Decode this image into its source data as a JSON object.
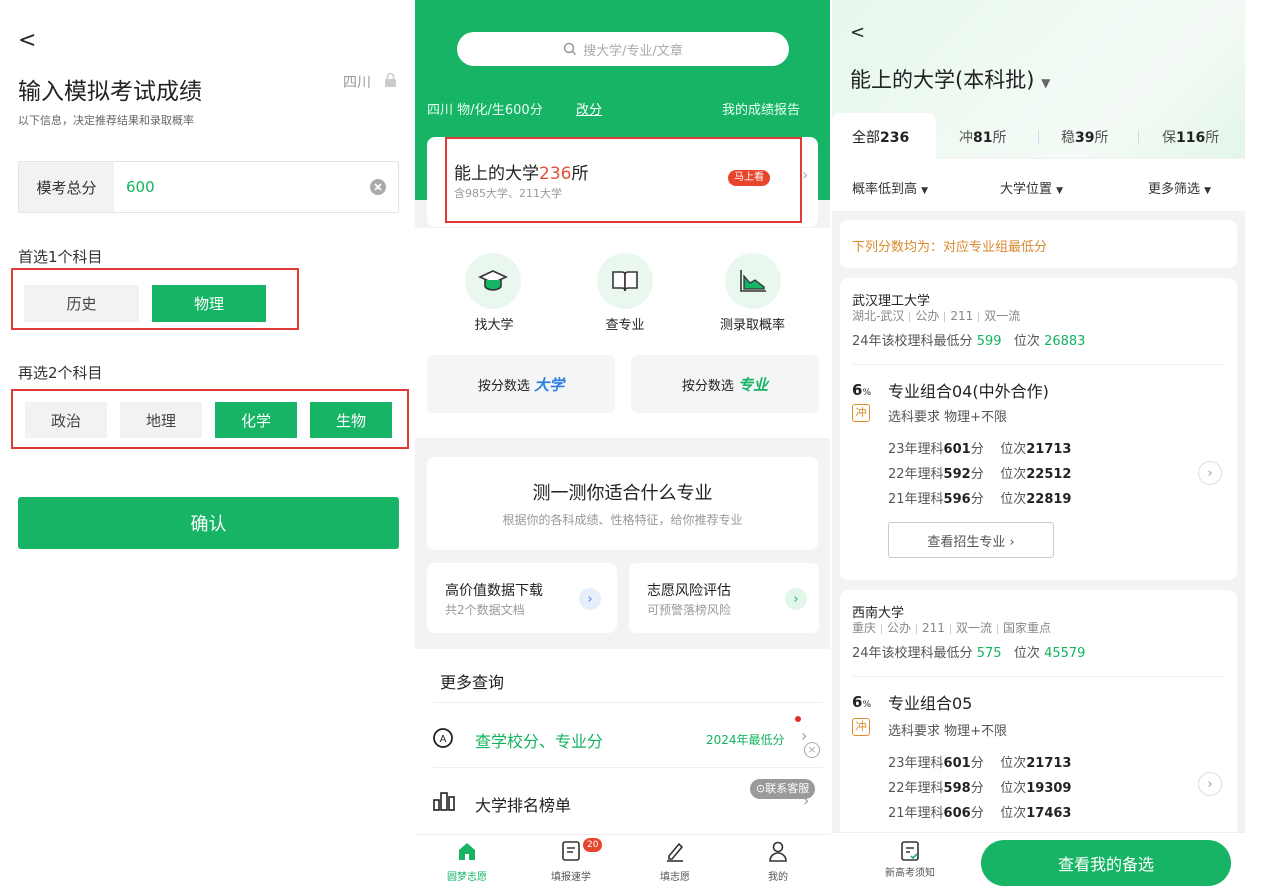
{
  "left": {
    "back": "<",
    "title": "输入模拟考试成绩",
    "province": "四川",
    "subtitle": "以下信息，决定推荐结果和录取概率",
    "score_label": "模考总分",
    "score_value": "600",
    "first_label": "首选1个科目",
    "first_options": [
      "历史",
      "物理"
    ],
    "second_label": "再选2个科目",
    "second_options": [
      "政治",
      "地理",
      "化学",
      "生物"
    ],
    "confirm": "确认"
  },
  "middle": {
    "search_placeholder": "搜大学/专业/文章",
    "info": "四川 物/化/生600分",
    "change": "改分",
    "report": "我的成绩报告",
    "card_title_a": "能上的大学",
    "card_count": "236",
    "card_title_b": "所",
    "card_sub": "含985大学、211大学",
    "badge": "马上看",
    "quick": [
      "找大学",
      "查专业",
      "测录取概率"
    ],
    "score_a_prefix": "按分数选",
    "score_a_suffix": "大学",
    "score_b_prefix": "按分数选",
    "score_b_suffix": "专业",
    "quiz_title": "测一测你适合什么专业",
    "quiz_sub": "根据你的各科成绩、性格特征，给你推荐专业",
    "dl_title": "高价值数据下载",
    "dl_sub": "共2个数据文档",
    "risk_title": "志愿风险评估",
    "risk_sub": "可预警落榜风险",
    "more": "更多查询",
    "query1": "查学校分、专业分",
    "query1_right": "2024年最低分",
    "query2": "大学排名榜单",
    "service": "联系客服",
    "nav": [
      "圆梦志愿",
      "填报速学",
      "填志愿",
      "我的"
    ],
    "nav_badge": "20"
  },
  "right": {
    "back": "<",
    "title": "能上的大学(本科批)",
    "tabs": [
      {
        "a": "全部",
        "b": "236",
        "c": ""
      },
      {
        "a": "冲",
        "b": "81",
        "c": "所"
      },
      {
        "a": "稳",
        "b": "39",
        "c": "所"
      },
      {
        "a": "保",
        "b": "116",
        "c": "所"
      }
    ],
    "filters": [
      "概率低到高",
      "大学位置",
      "更多筛选"
    ],
    "notice": "下列分数均为：对应专业组最低分",
    "schools": [
      {
        "name": "武汉理工大学",
        "tags": [
          "湖北-武汉",
          "公办",
          "211",
          "双一流"
        ],
        "min_prefix": "24年该校理科最低分",
        "min_score": "599",
        "rank_label": "位次",
        "rank": "26883",
        "prob": "6",
        "prob_unit": "%",
        "group": "专业组合04(中外合作)",
        "tag": "冲",
        "req": "选科要求 物理+不限",
        "rows": [
          {
            "y": "23年理科",
            "s": "601",
            "u": "分",
            "rl": "位次",
            "r": "21713"
          },
          {
            "y": "22年理科",
            "s": "592",
            "u": "分",
            "rl": "位次",
            "r": "22512"
          },
          {
            "y": "21年理科",
            "s": "596",
            "u": "分",
            "rl": "位次",
            "r": "22819"
          }
        ],
        "button": "查看招生专业 ›"
      },
      {
        "name": "西南大学",
        "tags": [
          "重庆",
          "公办",
          "211",
          "双一流",
          "国家重点"
        ],
        "min_prefix": "24年该校理科最低分",
        "min_score": "575",
        "rank_label": "位次",
        "rank": "45579",
        "prob": "6",
        "prob_unit": "%",
        "group": "专业组合05",
        "tag": "冲",
        "req": "选科要求 物理+不限",
        "rows": [
          {
            "y": "23年理科",
            "s": "601",
            "u": "分",
            "rl": "位次",
            "r": "21713"
          },
          {
            "y": "22年理科",
            "s": "598",
            "u": "分",
            "rl": "位次",
            "r": "19309"
          },
          {
            "y": "21年理科",
            "s": "606",
            "u": "分",
            "rl": "位次",
            "r": "17463"
          }
        ]
      }
    ],
    "bottom_left": "新高考须知",
    "bottom_btn": "查看我的备选"
  },
  "colors": {
    "green": "#16b464",
    "red_box": "#e03b36",
    "orange": "#e07a2e"
  }
}
